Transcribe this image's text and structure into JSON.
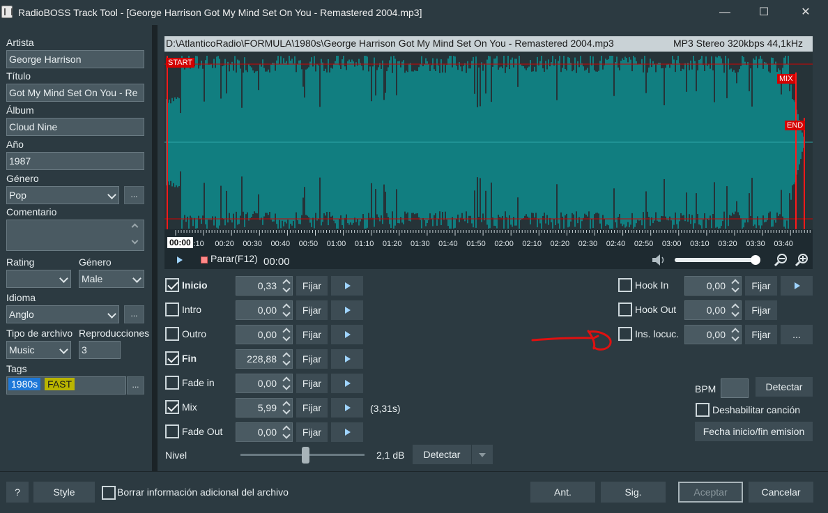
{
  "window": {
    "title": "RadioBOSS Track Tool - [George Harrison Got My Mind Set On You - Remastered 2004.mp3]",
    "minimize": "—",
    "maximize": "☐",
    "close": "✕"
  },
  "metadata": {
    "artist_label": "Artista",
    "artist_value": "George Harrison",
    "title_label": "Título",
    "title_value": "Got My Mind Set On You - Re",
    "album_label": "Álbum",
    "album_value": "Cloud Nine",
    "year_label": "Año",
    "year_value": "1987",
    "genre_label": "Género",
    "genre_value": "Pop",
    "comment_label": "Comentario",
    "comment_value": "",
    "rating_label": "Rating",
    "rating_value": "",
    "gender_label": "Género",
    "gender_value": "Male",
    "language_label": "Idioma",
    "language_value": "Anglo",
    "filetype_label": "Tipo de archivo",
    "filetype_value": "Music",
    "plays_label": "Reproducciones",
    "plays_value": "3",
    "tags_label": "Tags",
    "tags": [
      "1980s",
      "FAST"
    ],
    "tag_colors": [
      "#1e78d8",
      "#b9b400"
    ],
    "ellipsis": "..."
  },
  "file": {
    "path": "D:\\AtlanticoRadio\\FORMULA\\1980s\\George Harrison Got My Mind Set On You - Remastered 2004.mp3",
    "format": "MP3 Stereo 320kbps 44,1kHz"
  },
  "waveform": {
    "markers": {
      "start": "START",
      "mix": "MIX",
      "end": "END"
    },
    "cursor_time": "00:00",
    "timeline": [
      "0:10",
      "00:20",
      "00:30",
      "00:40",
      "00:50",
      "01:00",
      "01:10",
      "01:20",
      "01:30",
      "01:40",
      "01:50",
      "02:00",
      "02:10",
      "02:20",
      "02:30",
      "02:40",
      "02:50",
      "03:00",
      "03:10",
      "03:20",
      "03:30",
      "03:40"
    ],
    "wave_color": "#117e80",
    "marker_color": "#d40000"
  },
  "transport": {
    "stop_label": "Parar(F12)",
    "time": "00:00",
    "volume_level": 0.95
  },
  "cues": [
    {
      "label": "Inicio",
      "value": "0,33",
      "checked": true,
      "bold": true,
      "fix": "Fijar",
      "extra": ""
    },
    {
      "label": "Intro",
      "value": "0,00",
      "checked": false,
      "bold": false,
      "fix": "Fijar",
      "extra": ""
    },
    {
      "label": "Outro",
      "value": "0,00",
      "checked": false,
      "bold": false,
      "fix": "Fijar",
      "extra": ""
    },
    {
      "label": "Fin",
      "value": "228,88",
      "checked": true,
      "bold": true,
      "fix": "Fijar",
      "extra": ""
    },
    {
      "label": "Fade in",
      "value": "0,00",
      "checked": false,
      "bold": false,
      "fix": "Fijar",
      "extra": ""
    },
    {
      "label": "Mix",
      "value": "5,99",
      "checked": true,
      "bold": false,
      "fix": "Fijar",
      "extra": "(3,31s)"
    },
    {
      "label": "Fade Out",
      "value": "0,00",
      "checked": false,
      "bold": false,
      "fix": "Fijar",
      "extra": ""
    }
  ],
  "level": {
    "label": "Nivel",
    "value": "2,1 dB",
    "slider_fraction": 0.52,
    "detect": "Detectar"
  },
  "hooks": [
    {
      "label": "Hook In",
      "value": "0,00",
      "fix": "Fijar",
      "side": "play"
    },
    {
      "label": "Hook Out",
      "value": "0,00",
      "fix": "Fijar",
      "side": ""
    },
    {
      "label": "Ins. locuc.",
      "value": "0,00",
      "fix": "Fijar",
      "side": "..."
    }
  ],
  "bpm": {
    "label": "BPM",
    "value": "",
    "detect": "Detectar",
    "disable_label": "Deshabilitar canción",
    "date_button": "Fecha inicio/fin emision"
  },
  "footer": {
    "help": "?",
    "style": "Style",
    "erase_label": "Borrar información adicional del archivo",
    "prev": "Ant.",
    "next": "Sig.",
    "accept": "Aceptar",
    "cancel": "Cancelar"
  },
  "annotation_color": "#e01010"
}
